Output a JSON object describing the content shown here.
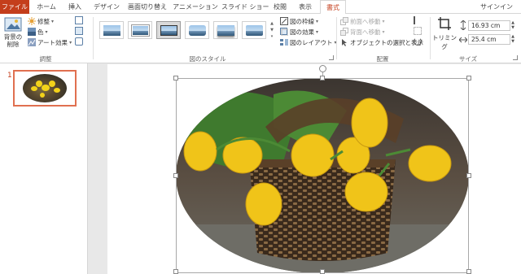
{
  "tabs": [
    {
      "label": "ファイル"
    },
    {
      "label": "ホーム"
    },
    {
      "label": "挿入"
    },
    {
      "label": "デザイン"
    },
    {
      "label": "画面切り替え"
    },
    {
      "label": "アニメーション"
    },
    {
      "label": "スライド ショー"
    },
    {
      "label": "校閲"
    },
    {
      "label": "表示"
    },
    {
      "label": "書式"
    }
  ],
  "signin": "サインイン",
  "ribbon": {
    "adjust": {
      "remove_bg": "背景の削除",
      "corrections": "修整",
      "color": "色",
      "artistic": "アート効果",
      "label": "調整"
    },
    "styles": {
      "border": "図の枠線",
      "effects": "図の効果",
      "layout": "図のレイアウト",
      "label": "図のスタイル"
    },
    "arrange": {
      "forward": "前面へ移動",
      "backward": "背面へ移動",
      "selection_pane": "オブジェクトの選択と表示",
      "label": "配置"
    },
    "size": {
      "crop": "トリミング",
      "height": "16.93 cm",
      "width": "25.4 cm",
      "label": "サイズ"
    }
  },
  "slides": [
    {
      "number": "1"
    }
  ],
  "colors": {
    "file_tab": "#c43e1c",
    "accent": "#c43e1c",
    "thumb_border": "#e07050"
  }
}
